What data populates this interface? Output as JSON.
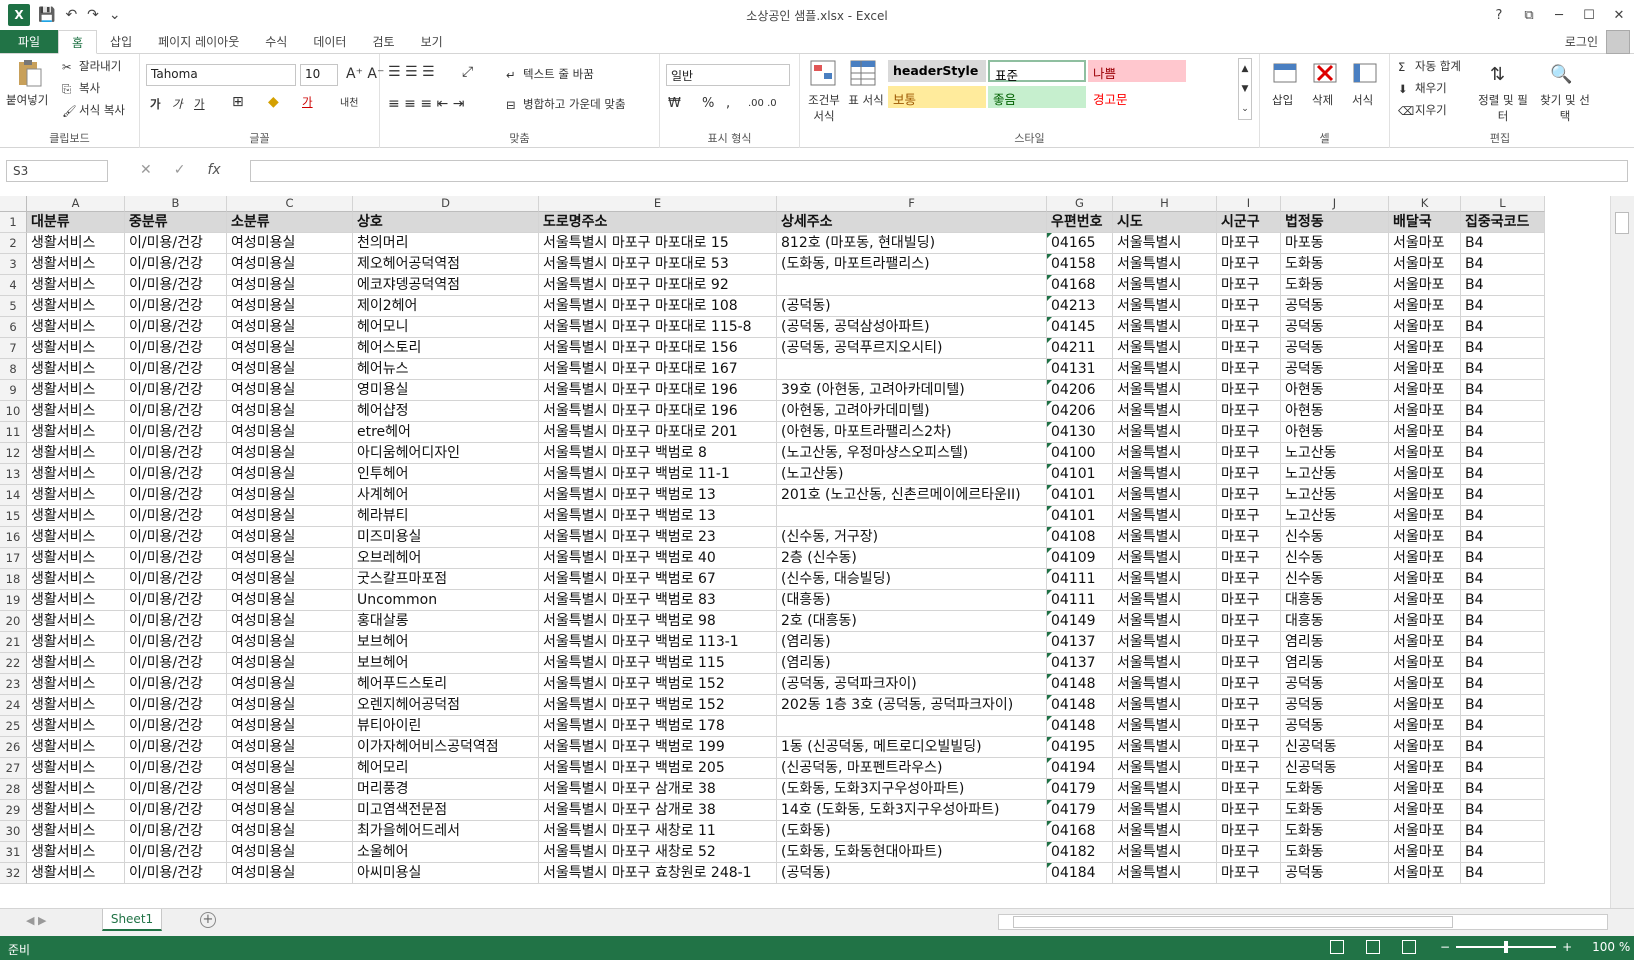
{
  "window": {
    "title": "소상공인 샘플.xlsx - Excel",
    "app_logo": "X",
    "help": "?",
    "restore_ribbon": "⧉",
    "minimize": "─",
    "maximize": "☐",
    "close": "✕"
  },
  "qat": {
    "save": "💾",
    "undo": "↶",
    "redo": "↷",
    "customize": "⌄"
  },
  "tabs": [
    "파일",
    "홈",
    "삽입",
    "페이지 레이아웃",
    "수식",
    "데이터",
    "검토",
    "보기"
  ],
  "account": "로그인",
  "ribbon": {
    "clipboard": {
      "label": "클립보드",
      "paste": "붙여넣기",
      "cut": "잘라내기",
      "copy": "복사",
      "format_painter": "서식 복사"
    },
    "font": {
      "label": "글꼴",
      "font_name": "Tahoma",
      "font_size": "10",
      "bold": "가",
      "italic": "가",
      "underline": "가",
      "color_a": "가",
      "phonetic": "내천"
    },
    "alignment": {
      "label": "맞춤",
      "wrap": "텍스트 줄 바꿈",
      "merge": "병합하고 가운데 맞춤"
    },
    "number": {
      "label": "표시 형식",
      "format": "일반",
      "percent": "%",
      "comma": ","
    },
    "styles": {
      "label": "스타일",
      "conditional": "조건부 서식",
      "table": "표 서식",
      "cells": [
        {
          "name": "headerStyle",
          "bg": "#d9d9d9",
          "fg": "#000000"
        },
        {
          "name": "표준",
          "bg": "#ffffff",
          "fg": "#000000"
        },
        {
          "name": "나쁨",
          "bg": "#ffc7ce",
          "fg": "#9c0006"
        },
        {
          "name": "보통",
          "bg": "#ffeb9c",
          "fg": "#9c5700"
        },
        {
          "name": "좋음",
          "bg": "#c6efce",
          "fg": "#006100"
        },
        {
          "name": "경고문",
          "bg": "#ffffff",
          "fg": "#ff0000"
        }
      ]
    },
    "cells": {
      "label": "셀",
      "insert": "삽입",
      "delete": "삭제",
      "format": "서식"
    },
    "editing": {
      "label": "편집",
      "autosum": "자동 합계",
      "fill": "채우기",
      "clear": "지우기",
      "sort_filter": "정렬 및 필터",
      "find_select": "찾기 및 선택"
    }
  },
  "formula_bar": {
    "name_box": "S3",
    "cancel": "✕",
    "enter": "✓",
    "fx": "fx",
    "value": ""
  },
  "columns": [
    "A",
    "B",
    "C",
    "D",
    "E",
    "F",
    "G",
    "H",
    "I",
    "J",
    "K",
    "L"
  ],
  "headers": [
    "대분류",
    "중분류",
    "소분류",
    "상호",
    "도로명주소",
    "상세주소",
    "우편번호",
    "시도",
    "시군구",
    "법정동",
    "배달국",
    "집중국코드"
  ],
  "rows": [
    [
      "생활서비스",
      "이/미용/건강",
      "여성미용실",
      "천의머리",
      "서울특별시 마포구 마포대로 15",
      "812호 (마포동, 현대빌딩)",
      "04165",
      "서울특별시",
      "마포구",
      "마포동",
      "서울마포",
      "B4"
    ],
    [
      "생활서비스",
      "이/미용/건강",
      "여성미용실",
      "제오헤어공덕역점",
      "서울특별시 마포구 마포대로 53",
      "(도화동, 마포트라팰리스)",
      "04158",
      "서울특별시",
      "마포구",
      "도화동",
      "서울마포",
      "B4"
    ],
    [
      "생활서비스",
      "이/미용/건강",
      "여성미용실",
      "에코쟈뎅공덕역점",
      "서울특별시 마포구 마포대로 92",
      "",
      "04168",
      "서울특별시",
      "마포구",
      "도화동",
      "서울마포",
      "B4"
    ],
    [
      "생활서비스",
      "이/미용/건강",
      "여성미용실",
      "제이2헤어",
      "서울특별시 마포구 마포대로 108",
      "(공덕동)",
      "04213",
      "서울특별시",
      "마포구",
      "공덕동",
      "서울마포",
      "B4"
    ],
    [
      "생활서비스",
      "이/미용/건강",
      "여성미용실",
      "헤어모니",
      "서울특별시 마포구 마포대로 115-8",
      "(공덕동, 공덕삼성아파트)",
      "04145",
      "서울특별시",
      "마포구",
      "공덕동",
      "서울마포",
      "B4"
    ],
    [
      "생활서비스",
      "이/미용/건강",
      "여성미용실",
      "헤어스토리",
      "서울특별시 마포구 마포대로 156",
      "(공덕동, 공덕푸르지오시티)",
      "04211",
      "서울특별시",
      "마포구",
      "공덕동",
      "서울마포",
      "B4"
    ],
    [
      "생활서비스",
      "이/미용/건강",
      "여성미용실",
      "헤어뉴스",
      "서울특별시 마포구 마포대로 167",
      "",
      "04131",
      "서울특별시",
      "마포구",
      "공덕동",
      "서울마포",
      "B4"
    ],
    [
      "생활서비스",
      "이/미용/건강",
      "여성미용실",
      "영미용실",
      "서울특별시 마포구 마포대로 196",
      "39호 (아현동, 고려아카데미텔)",
      "04206",
      "서울특별시",
      "마포구",
      "아현동",
      "서울마포",
      "B4"
    ],
    [
      "생활서비스",
      "이/미용/건강",
      "여성미용실",
      "헤어샵정",
      "서울특별시 마포구 마포대로 196",
      "(아현동, 고려아카데미텔)",
      "04206",
      "서울특별시",
      "마포구",
      "아현동",
      "서울마포",
      "B4"
    ],
    [
      "생활서비스",
      "이/미용/건강",
      "여성미용실",
      "etre헤어",
      "서울특별시 마포구 마포대로 201",
      "(아현동, 마포트라팰리스2차)",
      "04130",
      "서울특별시",
      "마포구",
      "아현동",
      "서울마포",
      "B4"
    ],
    [
      "생활서비스",
      "이/미용/건강",
      "여성미용실",
      "아디움헤어디자인",
      "서울특별시 마포구 백범로 8",
      "(노고산동, 우정마샹스오피스텔)",
      "04100",
      "서울특별시",
      "마포구",
      "노고산동",
      "서울마포",
      "B4"
    ],
    [
      "생활서비스",
      "이/미용/건강",
      "여성미용실",
      "인투헤어",
      "서울특별시 마포구 백범로 11-1",
      "(노고산동)",
      "04101",
      "서울특별시",
      "마포구",
      "노고산동",
      "서울마포",
      "B4"
    ],
    [
      "생활서비스",
      "이/미용/건강",
      "여성미용실",
      "사계헤어",
      "서울특별시 마포구 백범로 13",
      "201호 (노고산동, 신촌르메이에르타운II)",
      "04101",
      "서울특별시",
      "마포구",
      "노고산동",
      "서울마포",
      "B4"
    ],
    [
      "생활서비스",
      "이/미용/건강",
      "여성미용실",
      "헤라뷰티",
      "서울특별시 마포구 백범로 13",
      "",
      "04101",
      "서울특별시",
      "마포구",
      "노고산동",
      "서울마포",
      "B4"
    ],
    [
      "생활서비스",
      "이/미용/건강",
      "여성미용실",
      "미즈미용실",
      "서울특별시 마포구 백범로 23",
      "(신수동, 거구장)",
      "04108",
      "서울특별시",
      "마포구",
      "신수동",
      "서울마포",
      "B4"
    ],
    [
      "생활서비스",
      "이/미용/건강",
      "여성미용실",
      "오브레헤어",
      "서울특별시 마포구 백범로 40",
      "2층 (신수동)",
      "04109",
      "서울특별시",
      "마포구",
      "신수동",
      "서울마포",
      "B4"
    ],
    [
      "생활서비스",
      "이/미용/건강",
      "여성미용실",
      "굿스칼프마포점",
      "서울특별시 마포구 백범로 67",
      "(신수동, 대승빌딩)",
      "04111",
      "서울특별시",
      "마포구",
      "신수동",
      "서울마포",
      "B4"
    ],
    [
      "생활서비스",
      "이/미용/건강",
      "여성미용실",
      "Uncommon",
      "서울특별시 마포구 백범로 83",
      "(대흥동)",
      "04111",
      "서울특별시",
      "마포구",
      "대흥동",
      "서울마포",
      "B4"
    ],
    [
      "생활서비스",
      "이/미용/건강",
      "여성미용실",
      "홍대살롱",
      "서울특별시 마포구 백범로 98",
      "2호 (대흥동)",
      "04149",
      "서울특별시",
      "마포구",
      "대흥동",
      "서울마포",
      "B4"
    ],
    [
      "생활서비스",
      "이/미용/건강",
      "여성미용실",
      "보브헤어",
      "서울특별시 마포구 백범로 113-1",
      "(염리동)",
      "04137",
      "서울특별시",
      "마포구",
      "염리동",
      "서울마포",
      "B4"
    ],
    [
      "생활서비스",
      "이/미용/건강",
      "여성미용실",
      "보브헤어",
      "서울특별시 마포구 백범로 115",
      "(염리동)",
      "04137",
      "서울특별시",
      "마포구",
      "염리동",
      "서울마포",
      "B4"
    ],
    [
      "생활서비스",
      "이/미용/건강",
      "여성미용실",
      "헤어푸드스토리",
      "서울특별시 마포구 백범로 152",
      "(공덕동, 공덕파크자이)",
      "04148",
      "서울특별시",
      "마포구",
      "공덕동",
      "서울마포",
      "B4"
    ],
    [
      "생활서비스",
      "이/미용/건강",
      "여성미용실",
      "오렌지헤어공덕점",
      "서울특별시 마포구 백범로 152",
      "202동 1층 3호 (공덕동, 공덕파크자이)",
      "04148",
      "서울특별시",
      "마포구",
      "공덕동",
      "서울마포",
      "B4"
    ],
    [
      "생활서비스",
      "이/미용/건강",
      "여성미용실",
      "뷰티아이린",
      "서울특별시 마포구 백범로 178",
      "",
      "04148",
      "서울특별시",
      "마포구",
      "공덕동",
      "서울마포",
      "B4"
    ],
    [
      "생활서비스",
      "이/미용/건강",
      "여성미용실",
      "이가자헤어비스공덕역점",
      "서울특별시 마포구 백범로 199",
      "1동 (신공덕동, 메트로디오빌빌딩)",
      "04195",
      "서울특별시",
      "마포구",
      "신공덕동",
      "서울마포",
      "B4"
    ],
    [
      "생활서비스",
      "이/미용/건강",
      "여성미용실",
      "헤어모리",
      "서울특별시 마포구 백범로 205",
      "(신공덕동, 마포펜트라우스)",
      "04194",
      "서울특별시",
      "마포구",
      "신공덕동",
      "서울마포",
      "B4"
    ],
    [
      "생활서비스",
      "이/미용/건강",
      "여성미용실",
      "머리풍경",
      "서울특별시 마포구 삼개로 38",
      "(도화동, 도화3지구우성아파트)",
      "04179",
      "서울특별시",
      "마포구",
      "도화동",
      "서울마포",
      "B4"
    ],
    [
      "생활서비스",
      "이/미용/건강",
      "여성미용실",
      "미고염색전문점",
      "서울특별시 마포구 삼개로 38",
      "14호 (도화동, 도화3지구우성아파트)",
      "04179",
      "서울특별시",
      "마포구",
      "도화동",
      "서울마포",
      "B4"
    ],
    [
      "생활서비스",
      "이/미용/건강",
      "여성미용실",
      "최가을헤어드레서",
      "서울특별시 마포구 새창로 11",
      "(도화동)",
      "04168",
      "서울특별시",
      "마포구",
      "도화동",
      "서울마포",
      "B4"
    ],
    [
      "생활서비스",
      "이/미용/건강",
      "여성미용실",
      "소울헤어",
      "서울특별시 마포구 새창로 52",
      "(도화동, 도화동현대아파트)",
      "04182",
      "서울특별시",
      "마포구",
      "도화동",
      "서울마포",
      "B4"
    ],
    [
      "생활서비스",
      "이/미용/건강",
      "여성미용실",
      "아씨미용실",
      "서울특별시 마포구 효창원로 248-1",
      "(공덕동)",
      "04184",
      "서울특별시",
      "마포구",
      "공덕동",
      "서울마포",
      "B4"
    ]
  ],
  "sheet_tabs": [
    "Sheet1"
  ],
  "status": {
    "ready": "준비",
    "zoom": "100 %",
    "zoom_out": "−",
    "zoom_in": "+"
  }
}
